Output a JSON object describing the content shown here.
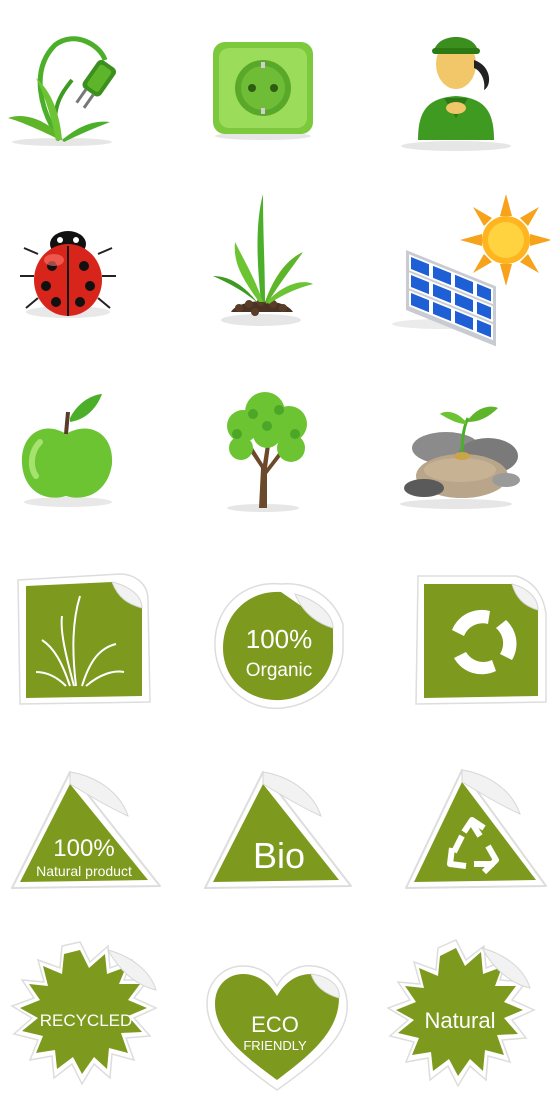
{
  "colors": {
    "sticker_green": "#7d9a1e",
    "sticker_green_dark": "#6b8618",
    "leaf_green": "#5fb52a",
    "white": "#ffffff"
  },
  "icons": [
    "plant-plug-icon",
    "power-socket-icon",
    "farmer-avatar-icon",
    "ladybug-icon",
    "grass-sprout-icon",
    "solar-panel-sun-icon",
    "green-apple-icon",
    "leafy-tree-icon",
    "stones-sprout-icon"
  ],
  "stickers": {
    "organic": {
      "line1": "100%",
      "line2": "Organic"
    },
    "natural_product": {
      "line1": "100%",
      "line2": "Natural product"
    },
    "bio": {
      "text": "Bio"
    },
    "recycled": {
      "text": "RECYCLED"
    },
    "eco_friendly": {
      "line1": "ECO",
      "line2": "FRIENDLY"
    },
    "natural": {
      "text": "Natural"
    }
  }
}
